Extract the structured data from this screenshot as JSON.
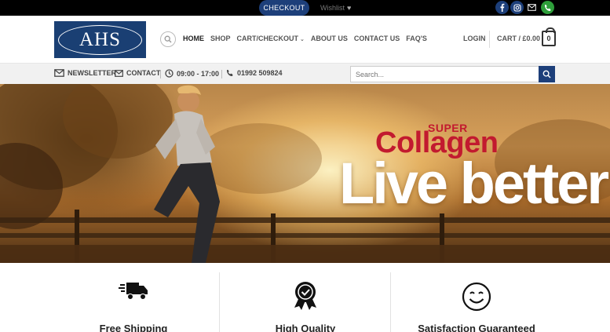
{
  "topbar": {
    "checkout_label": "CHECKOUT",
    "wishlist_label": "Wishlist",
    "social_icons": [
      "facebook-icon",
      "instagram-icon",
      "email-icon",
      "phone-icon"
    ],
    "colors": {
      "facebook": "#1d3f7a",
      "instagram": "#1d3f7a",
      "phone": "#2e9e3a"
    }
  },
  "header": {
    "logo_text": "AHS",
    "nav": [
      {
        "label": "HOME",
        "active": true
      },
      {
        "label": "SHOP"
      },
      {
        "label": "CART/CHECKOUT",
        "has_dropdown": true
      },
      {
        "label": "ABOUT US"
      },
      {
        "label": "CONTACT US"
      },
      {
        "label": "FAQ'S"
      }
    ],
    "login_label": "LOGIN",
    "cart_label": "CART / £0.00",
    "cart_count": "0"
  },
  "subbar": {
    "newsletter_label": "NEWSLETTER",
    "contact_label": "CONTACT",
    "hours_label": "09:00 - 17:00",
    "phone_label": "01992 509824",
    "search_placeholder": "Search..."
  },
  "hero": {
    "super_text": "SUPER",
    "brand_text": "Collagen",
    "tagline": "Live better"
  },
  "features": [
    {
      "label": "Free Shipping",
      "icon": "delivery-truck-icon"
    },
    {
      "label": "High Quality",
      "icon": "award-ribbon-icon"
    },
    {
      "label": "Satisfaction Guaranteed",
      "icon": "smiley-face-icon"
    }
  ],
  "brand_colors": {
    "primary": "#1d3f7a",
    "accent_red": "#c21a2f"
  }
}
